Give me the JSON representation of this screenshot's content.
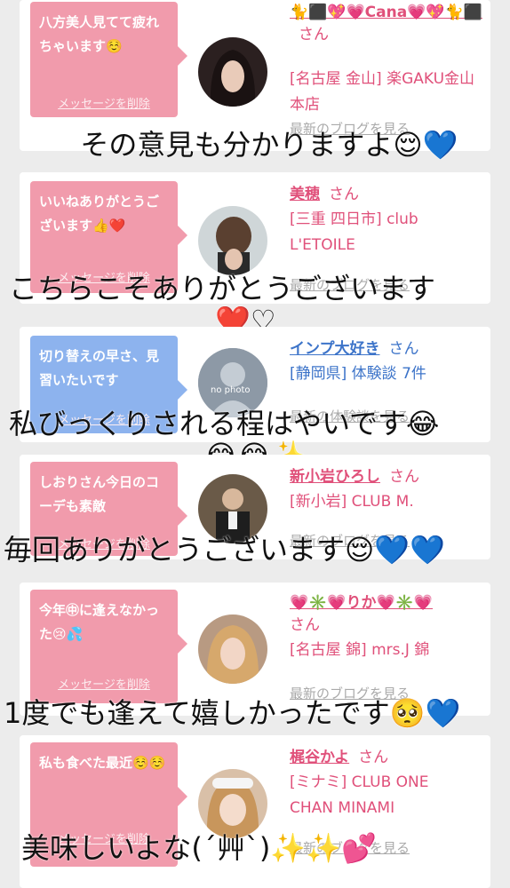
{
  "items": [
    {
      "bubble": "八方美人見てて疲れちゃいます☺️",
      "delete": "メッセージを削除",
      "name": "🐈⬛💖💗Cana💗💖🐈⬛",
      "san": "さん",
      "shop": "[名古屋 金山] 楽GAKU金山本店",
      "blog": "最新のブログを見る",
      "reply": "その意見も分かりますよ😌💙",
      "avatar_color": "#2b2020"
    },
    {
      "bubble": "いいねありがとうございます👍❤️",
      "delete": "メッセージを削除",
      "name": "美穂",
      "san": "さん",
      "shop": "[三重 四日市] club L'ETOILE",
      "blog": "最新のブログを見る",
      "reply": "こちらこそありがとうございます",
      "reply2": "❤️♡",
      "avatar_color": "#5a4a3a"
    },
    {
      "bubble": "切り替えの早さ、見習いたいです",
      "delete": "メッセージを削除",
      "name": "インプ大好き",
      "san": "さん",
      "shop": "[静岡県] 体験談 7件",
      "blog": "最新の体験談を見る",
      "reply": "私びっくりされる程はやいです😂",
      "reply2": "😂😂✨",
      "avatar_text": "no photo",
      "avatar_color": "#9aa6b2"
    },
    {
      "bubble": "しおりさん今日のコーデも素敵",
      "delete": "メッセージを削除",
      "name": "新小岩ひろし",
      "san": "さん",
      "shop": "[新小岩] CLUB M.",
      "blog": "最新のブログを見る",
      "reply": "毎回ありがとうございます😌💙💙",
      "avatar_color": "#3b342c"
    },
    {
      "bubble": "今年㊥に逢えなかった😢💦",
      "delete": "メッセージを削除",
      "name": "💗✳️💗りか💗✳️💗",
      "san": "さん",
      "shop": "[名古屋 錦] mrs.J 錦",
      "blog": "最新のブログを見る",
      "reply": "1度でも逢えて嬉しかったです🥺💙",
      "avatar_color": "#c9a48a"
    },
    {
      "bubble": "私も食べた最近☺️☺️",
      "delete": "メッセージを削除",
      "name": "梶谷かよ",
      "san": "さん",
      "shop": "[ミナミ] CLUB ONE CHAN MINAMI",
      "blog": "最新のブログを見る",
      "reply": "美味しいよな(´艸`)✨✨💕",
      "avatar_color": "#d9c0a8"
    }
  ]
}
